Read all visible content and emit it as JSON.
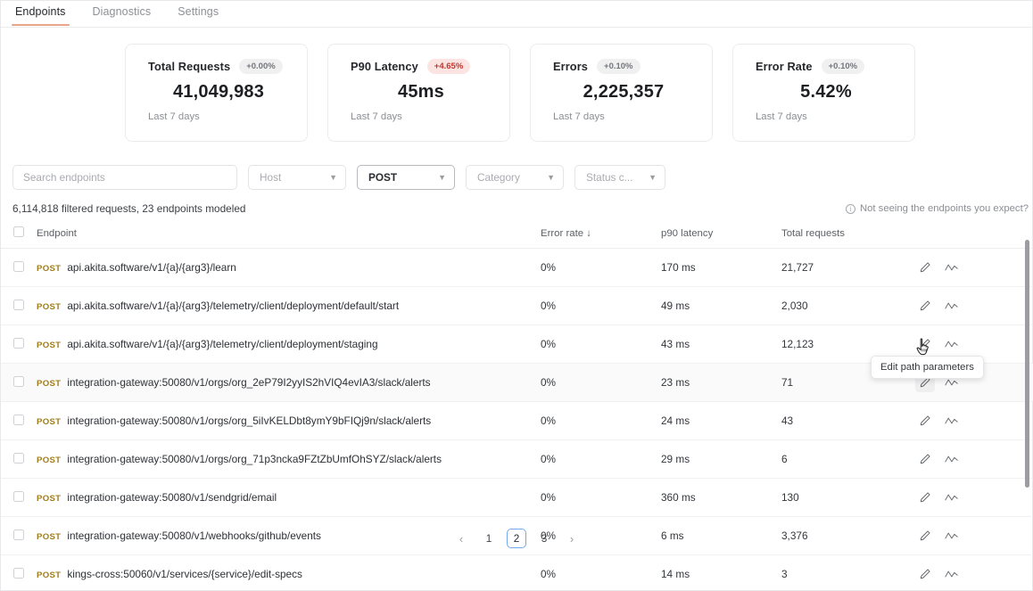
{
  "tabs": [
    {
      "label": "Endpoints",
      "active": true
    },
    {
      "label": "Diagnostics",
      "active": false
    },
    {
      "label": "Settings",
      "active": false
    }
  ],
  "cards": [
    {
      "title": "Total Requests",
      "delta": "+0.00%",
      "delta_kind": "neutral",
      "value": "41,049,983",
      "sub": "Last 7 days"
    },
    {
      "title": "P90 Latency",
      "delta": "+4.65%",
      "delta_kind": "warn",
      "value": "45ms",
      "sub": "Last 7 days"
    },
    {
      "title": "Errors",
      "delta": "+0.10%",
      "delta_kind": "neutral",
      "value": "2,225,357",
      "sub": "Last 7 days"
    },
    {
      "title": "Error Rate",
      "delta": "+0.10%",
      "delta_kind": "neutral",
      "value": "5.42%",
      "sub": "Last 7 days"
    }
  ],
  "filters": {
    "search_placeholder": "Search endpoints",
    "search_value": "",
    "host": {
      "label": "Host",
      "selected": false
    },
    "method": {
      "label": "POST",
      "selected": true
    },
    "category": {
      "label": "Category",
      "selected": false
    },
    "status": {
      "label": "Status c...",
      "selected": false
    }
  },
  "info": {
    "summary": "6,114,818 filtered requests, 23 endpoints modeled",
    "help_link": "Not seeing the endpoints you expect?",
    "help_icon": "info-circle-icon"
  },
  "table": {
    "columns": [
      "Endpoint",
      "Error rate",
      "p90 latency",
      "Total requests"
    ],
    "sorted_column": "Error rate",
    "sort_direction": "desc",
    "sort_glyph": "↓",
    "rows": [
      {
        "method": "POST",
        "path": "api.akita.software/v1/{a}/{arg3}/learn",
        "error_rate": "0%",
        "p90": "170 ms",
        "requests": "21,727",
        "hovered": false
      },
      {
        "method": "POST",
        "path": "api.akita.software/v1/{a}/{arg3}/telemetry/client/deployment/default/start",
        "error_rate": "0%",
        "p90": "49 ms",
        "requests": "2,030",
        "hovered": false
      },
      {
        "method": "POST",
        "path": "api.akita.software/v1/{a}/{arg3}/telemetry/client/deployment/staging",
        "error_rate": "0%",
        "p90": "43 ms",
        "requests": "12,123",
        "hovered": false
      },
      {
        "method": "POST",
        "path": "integration-gateway:50080/v1/orgs/org_2eP79I2yyIS2hVIQ4evIA3/slack/alerts",
        "error_rate": "0%",
        "p90": "23 ms",
        "requests": "71",
        "hovered": true
      },
      {
        "method": "POST",
        "path": "integration-gateway:50080/v1/orgs/org_5iIvKELDbt8ymY9bFIQj9n/slack/alerts",
        "error_rate": "0%",
        "p90": "24 ms",
        "requests": "43",
        "hovered": false
      },
      {
        "method": "POST",
        "path": "integration-gateway:50080/v1/orgs/org_71p3ncka9FZtZbUmfOhSYZ/slack/alerts",
        "error_rate": "0%",
        "p90": "29 ms",
        "requests": "6",
        "hovered": false
      },
      {
        "method": "POST",
        "path": "integration-gateway:50080/v1/sendgrid/email",
        "error_rate": "0%",
        "p90": "360 ms",
        "requests": "130",
        "hovered": false
      },
      {
        "method": "POST",
        "path": "integration-gateway:50080/v1/webhooks/github/events",
        "error_rate": "0%",
        "p90": "6 ms",
        "requests": "3,376",
        "hovered": false
      },
      {
        "method": "POST",
        "path": "kings-cross:50060/v1/services/{service}/edit-specs",
        "error_rate": "0%",
        "p90": "14 ms",
        "requests": "3",
        "hovered": false
      }
    ],
    "row_actions": [
      {
        "icon": "pencil-edit-icon",
        "title": "Edit path parameters"
      },
      {
        "icon": "chart-line-icon",
        "title": "View trends"
      }
    ]
  },
  "tooltip": {
    "text": "Edit path parameters",
    "visible": true
  },
  "pagination": {
    "prev_glyph": "‹",
    "next_glyph": "›",
    "pages": [
      "1",
      "2",
      "3"
    ],
    "current": "2"
  },
  "colors": {
    "accent_tab": "#e9a48a",
    "method_post": "#a07c1c",
    "delta_warn_bg": "#fbe4e2",
    "delta_warn_text": "#c0392e",
    "delta_neutral_bg": "#f0f0f1",
    "page_active_border": "#74a8ef"
  }
}
